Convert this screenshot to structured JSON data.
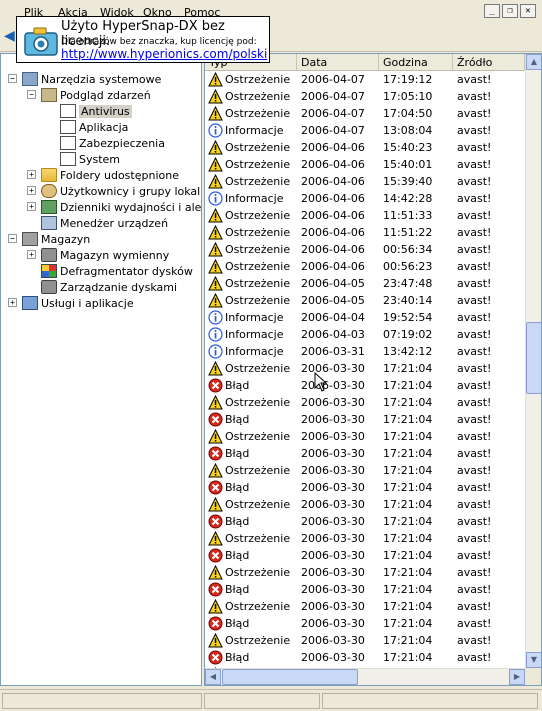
{
  "menu": {
    "items": [
      "Plik",
      "Akcja",
      "Widok",
      "Okno",
      "Pomoc"
    ]
  },
  "watermark": {
    "title": "Użyto HyperSnap-DX bez licencji.",
    "subtitle": "Dla obrazów bez znaczka, kup licencję pod:",
    "link": "http://www.hyperionics.com/polski"
  },
  "tree": {
    "items": [
      {
        "label": "Narzędzia systemowe",
        "icon": "tools-icon"
      },
      {
        "label": "Podgląd zdarzeń",
        "icon": "event-viewer-icon"
      },
      {
        "label": "Antivirus",
        "icon": "log-icon"
      },
      {
        "label": "Aplikacja",
        "icon": "log-icon"
      },
      {
        "label": "Zabezpieczenia",
        "icon": "log-icon"
      },
      {
        "label": "System",
        "icon": "log-icon"
      },
      {
        "label": "Foldery udostępnione",
        "icon": "shared-folder-icon"
      },
      {
        "label": "Użytkownicy i grupy lokalne",
        "icon": "users-icon"
      },
      {
        "label": "Dzienniki wydajności i alerty",
        "icon": "performance-icon"
      },
      {
        "label": "Menedżer urządzeń",
        "icon": "computer-icon"
      },
      {
        "label": "Magazyn",
        "icon": "storage-icon"
      },
      {
        "label": "Magazyn wymienny",
        "icon": "removable-storage-icon"
      },
      {
        "label": "Defragmentator dysków",
        "icon": "defrag-icon"
      },
      {
        "label": "Zarządzanie dyskami",
        "icon": "disk-management-icon"
      },
      {
        "label": "Usługi i aplikacje",
        "icon": "services-icon"
      }
    ]
  },
  "list": {
    "columns": [
      "Typ",
      "Data",
      "Godzina",
      "Źródło"
    ],
    "rows": [
      {
        "type": "Ostrzeżenie",
        "icon": "warning-icon",
        "date": "2006-04-07",
        "time": "17:19:12",
        "source": "avast!"
      },
      {
        "type": "Ostrzeżenie",
        "icon": "warning-icon",
        "date": "2006-04-07",
        "time": "17:05:10",
        "source": "avast!"
      },
      {
        "type": "Ostrzeżenie",
        "icon": "warning-icon",
        "date": "2006-04-07",
        "time": "17:04:50",
        "source": "avast!"
      },
      {
        "type": "Informacje",
        "icon": "info-icon",
        "date": "2006-04-07",
        "time": "13:08:04",
        "source": "avast!"
      },
      {
        "type": "Ostrzeżenie",
        "icon": "warning-icon",
        "date": "2006-04-06",
        "time": "15:40:23",
        "source": "avast!"
      },
      {
        "type": "Ostrzeżenie",
        "icon": "warning-icon",
        "date": "2006-04-06",
        "time": "15:40:01",
        "source": "avast!"
      },
      {
        "type": "Ostrzeżenie",
        "icon": "warning-icon",
        "date": "2006-04-06",
        "time": "15:39:40",
        "source": "avast!"
      },
      {
        "type": "Informacje",
        "icon": "info-icon",
        "date": "2006-04-06",
        "time": "14:42:28",
        "source": "avast!"
      },
      {
        "type": "Ostrzeżenie",
        "icon": "warning-icon",
        "date": "2006-04-06",
        "time": "11:51:33",
        "source": "avast!"
      },
      {
        "type": "Ostrzeżenie",
        "icon": "warning-icon",
        "date": "2006-04-06",
        "time": "11:51:22",
        "source": "avast!"
      },
      {
        "type": "Ostrzeżenie",
        "icon": "warning-icon",
        "date": "2006-04-06",
        "time": "00:56:34",
        "source": "avast!"
      },
      {
        "type": "Ostrzeżenie",
        "icon": "warning-icon",
        "date": "2006-04-06",
        "time": "00:56:23",
        "source": "avast!"
      },
      {
        "type": "Ostrzeżenie",
        "icon": "warning-icon",
        "date": "2006-04-05",
        "time": "23:47:48",
        "source": "avast!"
      },
      {
        "type": "Ostrzeżenie",
        "icon": "warning-icon",
        "date": "2006-04-05",
        "time": "23:40:14",
        "source": "avast!"
      },
      {
        "type": "Informacje",
        "icon": "info-icon",
        "date": "2006-04-04",
        "time": "19:52:54",
        "source": "avast!"
      },
      {
        "type": "Informacje",
        "icon": "info-icon",
        "date": "2006-04-03",
        "time": "07:19:02",
        "source": "avast!"
      },
      {
        "type": "Informacje",
        "icon": "info-icon",
        "date": "2006-03-31",
        "time": "13:42:12",
        "source": "avast!"
      },
      {
        "type": "Ostrzeżenie",
        "icon": "warning-icon",
        "date": "2006-03-30",
        "time": "17:21:04",
        "source": "avast!"
      },
      {
        "type": "Błąd",
        "icon": "error-icon",
        "date": "2006-03-30",
        "time": "17:21:04",
        "source": "avast!"
      },
      {
        "type": "Ostrzeżenie",
        "icon": "warning-icon",
        "date": "2006-03-30",
        "time": "17:21:04",
        "source": "avast!"
      },
      {
        "type": "Błąd",
        "icon": "error-icon",
        "date": "2006-03-30",
        "time": "17:21:04",
        "source": "avast!"
      },
      {
        "type": "Ostrzeżenie",
        "icon": "warning-icon",
        "date": "2006-03-30",
        "time": "17:21:04",
        "source": "avast!"
      },
      {
        "type": "Błąd",
        "icon": "error-icon",
        "date": "2006-03-30",
        "time": "17:21:04",
        "source": "avast!"
      },
      {
        "type": "Ostrzeżenie",
        "icon": "warning-icon",
        "date": "2006-03-30",
        "time": "17:21:04",
        "source": "avast!"
      },
      {
        "type": "Błąd",
        "icon": "error-icon",
        "date": "2006-03-30",
        "time": "17:21:04",
        "source": "avast!"
      },
      {
        "type": "Ostrzeżenie",
        "icon": "warning-icon",
        "date": "2006-03-30",
        "time": "17:21:04",
        "source": "avast!"
      },
      {
        "type": "Błąd",
        "icon": "error-icon",
        "date": "2006-03-30",
        "time": "17:21:04",
        "source": "avast!"
      },
      {
        "type": "Ostrzeżenie",
        "icon": "warning-icon",
        "date": "2006-03-30",
        "time": "17:21:04",
        "source": "avast!"
      },
      {
        "type": "Błąd",
        "icon": "error-icon",
        "date": "2006-03-30",
        "time": "17:21:04",
        "source": "avast!"
      },
      {
        "type": "Ostrzeżenie",
        "icon": "warning-icon",
        "date": "2006-03-30",
        "time": "17:21:04",
        "source": "avast!"
      },
      {
        "type": "Błąd",
        "icon": "error-icon",
        "date": "2006-03-30",
        "time": "17:21:04",
        "source": "avast!"
      },
      {
        "type": "Ostrzeżenie",
        "icon": "warning-icon",
        "date": "2006-03-30",
        "time": "17:21:04",
        "source": "avast!"
      },
      {
        "type": "Błąd",
        "icon": "error-icon",
        "date": "2006-03-30",
        "time": "17:21:04",
        "source": "avast!"
      },
      {
        "type": "Ostrzeżenie",
        "icon": "warning-icon",
        "date": "2006-03-30",
        "time": "17:21:04",
        "source": "avast!"
      },
      {
        "type": "Błąd",
        "icon": "error-icon",
        "date": "2006-03-30",
        "time": "17:21:04",
        "source": "avast!"
      },
      {
        "type": "Ostrzeżenie",
        "icon": "warning-icon",
        "date": "2006-03-30",
        "time": "17:21:04",
        "source": "avast!"
      },
      {
        "type": "Błąd",
        "icon": "error-icon",
        "date": "2006-03-30",
        "time": "17:21:04",
        "source": "avast!"
      }
    ]
  },
  "colors": {
    "selection": "#d4d0c8",
    "warning": "#f7d21c",
    "error": "#d62a1f",
    "info": "#2a5bd7",
    "link": "#0000ee"
  }
}
